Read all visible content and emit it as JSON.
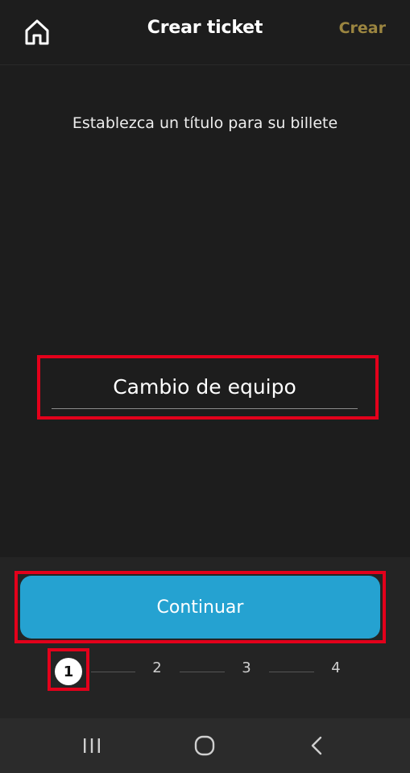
{
  "header": {
    "title": "Crear ticket",
    "create_label": "Crear",
    "home_icon": "home-icon"
  },
  "prompt": {
    "text": "Establezca un título para su billete"
  },
  "title_input": {
    "value": "Cambio de equipo"
  },
  "continue_button": {
    "label": "Continuar"
  },
  "stepper": {
    "current": "1",
    "steps": [
      "1",
      "2",
      "3",
      "4"
    ]
  },
  "navbar": {
    "icons": [
      "recent-apps-icon",
      "home-circle-icon",
      "back-icon"
    ]
  },
  "colors": {
    "background": "#1d1d1d",
    "accent": "#25a2d1",
    "create_text": "#9b8540",
    "highlight": "#e3001b"
  }
}
